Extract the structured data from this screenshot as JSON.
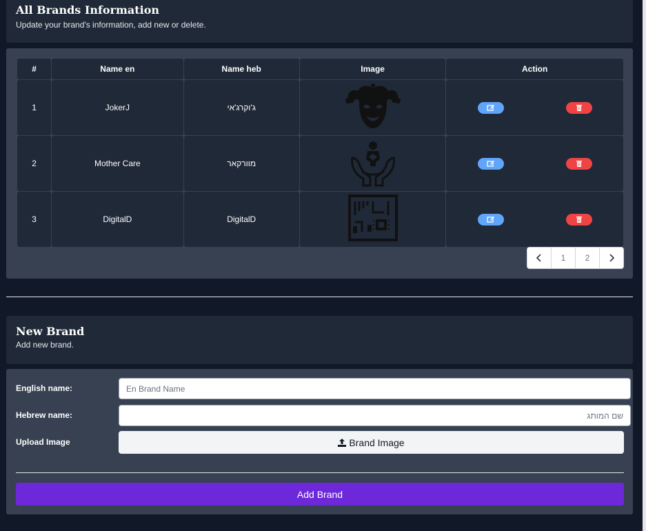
{
  "all_brands": {
    "title": "All Brands Information",
    "subtitle": "Update your brand's information, add new or delete."
  },
  "table": {
    "headers": [
      "#",
      "Name en",
      "Name heb",
      "Image",
      "Action"
    ],
    "rows": [
      {
        "num": "1",
        "name_en": "JokerJ",
        "name_heb": "ג'וקרג'אי",
        "image_icon": "jester-mask-icon"
      },
      {
        "num": "2",
        "name_en": "Mother Care",
        "name_heb": "מוורקאר",
        "image_icon": "hands-holding-baby-icon"
      },
      {
        "num": "3",
        "name_en": "DigitalD",
        "name_heb": "DigitalD",
        "image_icon": "circuit-board-icon"
      }
    ]
  },
  "pagination": {
    "prev_icon": "chevron-left-icon",
    "pages": [
      "1",
      "2"
    ],
    "next_icon": "chevron-right-icon"
  },
  "new_brand": {
    "title": "New Brand",
    "subtitle": "Add new brand."
  },
  "form": {
    "english_label": "English name:",
    "english_placeholder": "En Brand Name",
    "hebrew_label": "Hebrew name:",
    "hebrew_placeholder": "שם המותג",
    "upload_label": "Upload Image",
    "upload_button": "Brand Image",
    "submit_button": "Add Brand"
  },
  "colors": {
    "page_bg": "#111827",
    "card_bg": "#1f2937",
    "panel_bg": "#374151",
    "edit_button": "#60a5fa",
    "delete_button": "#ef4444",
    "submit_button": "#6d28d9"
  }
}
